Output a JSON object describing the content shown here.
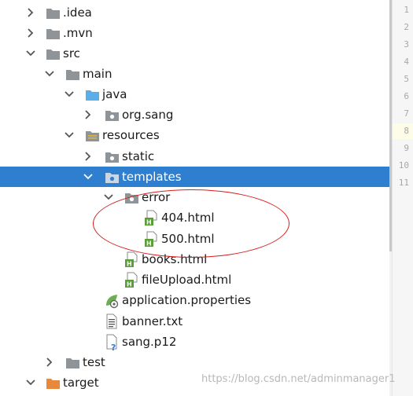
{
  "project_tree": {
    "items": [
      {
        "label": ".idea",
        "icon": "folder-icon"
      },
      {
        "label": ".mvn",
        "icon": "folder-icon"
      },
      {
        "label": "src",
        "icon": "folder-icon"
      },
      {
        "label": "main",
        "icon": "folder-icon"
      },
      {
        "label": "java",
        "icon": "source-root-folder-icon"
      },
      {
        "label": "org.sang",
        "icon": "package-icon"
      },
      {
        "label": "resources",
        "icon": "resources-folder-icon"
      },
      {
        "label": "static",
        "icon": "package-icon"
      },
      {
        "label": "templates",
        "icon": "package-icon",
        "selected": true
      },
      {
        "label": "error",
        "icon": "package-icon"
      },
      {
        "label": "404.html",
        "icon": "html-file-icon"
      },
      {
        "label": "500.html",
        "icon": "html-file-icon"
      },
      {
        "label": "books.html",
        "icon": "html-file-icon"
      },
      {
        "label": "fileUpload.html",
        "icon": "html-file-icon"
      },
      {
        "label": "application.properties",
        "icon": "spring-properties-icon"
      },
      {
        "label": "banner.txt",
        "icon": "text-file-icon"
      },
      {
        "label": "sang.p12",
        "icon": "unknown-file-icon"
      },
      {
        "label": "test",
        "icon": "folder-icon"
      },
      {
        "label": "target",
        "icon": "excluded-folder-icon"
      }
    ]
  },
  "editor_gutter": {
    "line_numbers": [
      "1",
      "2",
      "3",
      "4",
      "5",
      "6",
      "7",
      "8",
      "9",
      "10",
      "11"
    ],
    "current_line": "8"
  },
  "watermark": {
    "text": "https://blog.csdn.net/adminmanager1"
  },
  "colors": {
    "selection": "#2f7fd0",
    "folder": "#8f9499",
    "source_folder": "#5aafe8",
    "html_icon_green": "#5a9e3a",
    "annotation_ellipse": "#d81e1e"
  }
}
